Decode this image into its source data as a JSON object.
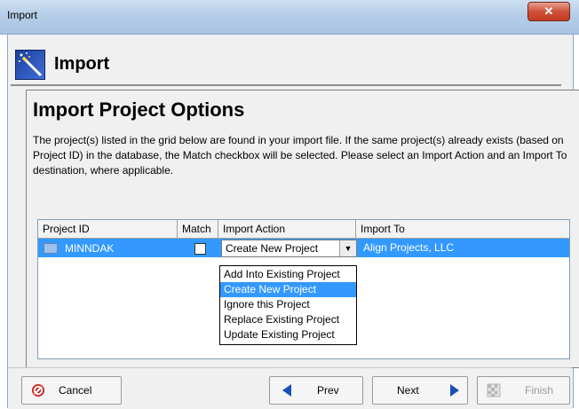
{
  "window": {
    "title": "Import",
    "close_icon": "close-icon"
  },
  "header": {
    "title": "Import",
    "icon": "magic-wand-icon"
  },
  "section": {
    "title": "Import Project Options",
    "description": "The project(s) listed in the grid below are found in your import file. If the same project(s) already exists (based on Project ID) in the database, the Match checkbox will be selected.  Please select an Import Action and an Import To destination, where applicable."
  },
  "grid": {
    "columns": [
      "Project ID",
      "Match",
      "Import Action",
      "Import To"
    ],
    "rows": [
      {
        "project_id": "MINNDAK",
        "match": false,
        "import_action": "Create New Project",
        "import_to": "Align Projects, LLC"
      }
    ]
  },
  "dropdown": {
    "options": [
      "Add Into Existing Project",
      "Create New Project",
      "Ignore this Project",
      "Replace Existing Project",
      "Update Existing Project"
    ],
    "selected": "Create New Project"
  },
  "buttons": {
    "cancel": "Cancel",
    "prev": "Prev",
    "next": "Next",
    "finish": "Finish"
  },
  "colors": {
    "selection": "#3399ff",
    "cancel_icon": "#d0231a",
    "arrow": "#1a4fb8"
  }
}
